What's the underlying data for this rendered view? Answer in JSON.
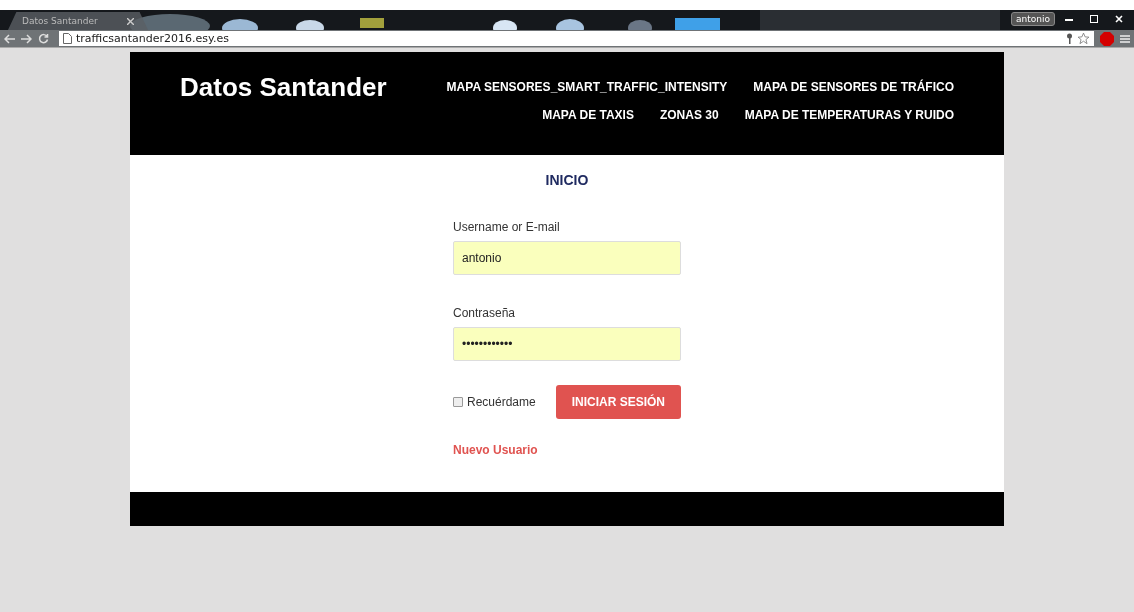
{
  "browser": {
    "tab_title": "Datos Santander",
    "profile": "antonio",
    "address": "trafficsantander2016.esy.es"
  },
  "site": {
    "brand": "Datos Santander",
    "nav": [
      {
        "label": "MAPA SENSORES_SMART_TRAFFIC_INTENSITY"
      },
      {
        "label": "MAPA DE SENSORES DE TRÁFICO"
      },
      {
        "label": "MAPA DE TAXIS"
      },
      {
        "label": "ZONAS 30"
      },
      {
        "label": "MAPA DE TEMPERATURAS Y RUIDO"
      }
    ]
  },
  "login": {
    "heading": "INICIO",
    "fields": [
      {
        "label": "Username or E-mail",
        "value": "antonio"
      },
      {
        "label": "Contraseña",
        "value": "••••••••••••"
      }
    ],
    "remember": {
      "label": "Recuérdame",
      "checked": false
    },
    "submit": "INICIAR SESIÓN",
    "register_link": "Nuevo Usuario"
  }
}
